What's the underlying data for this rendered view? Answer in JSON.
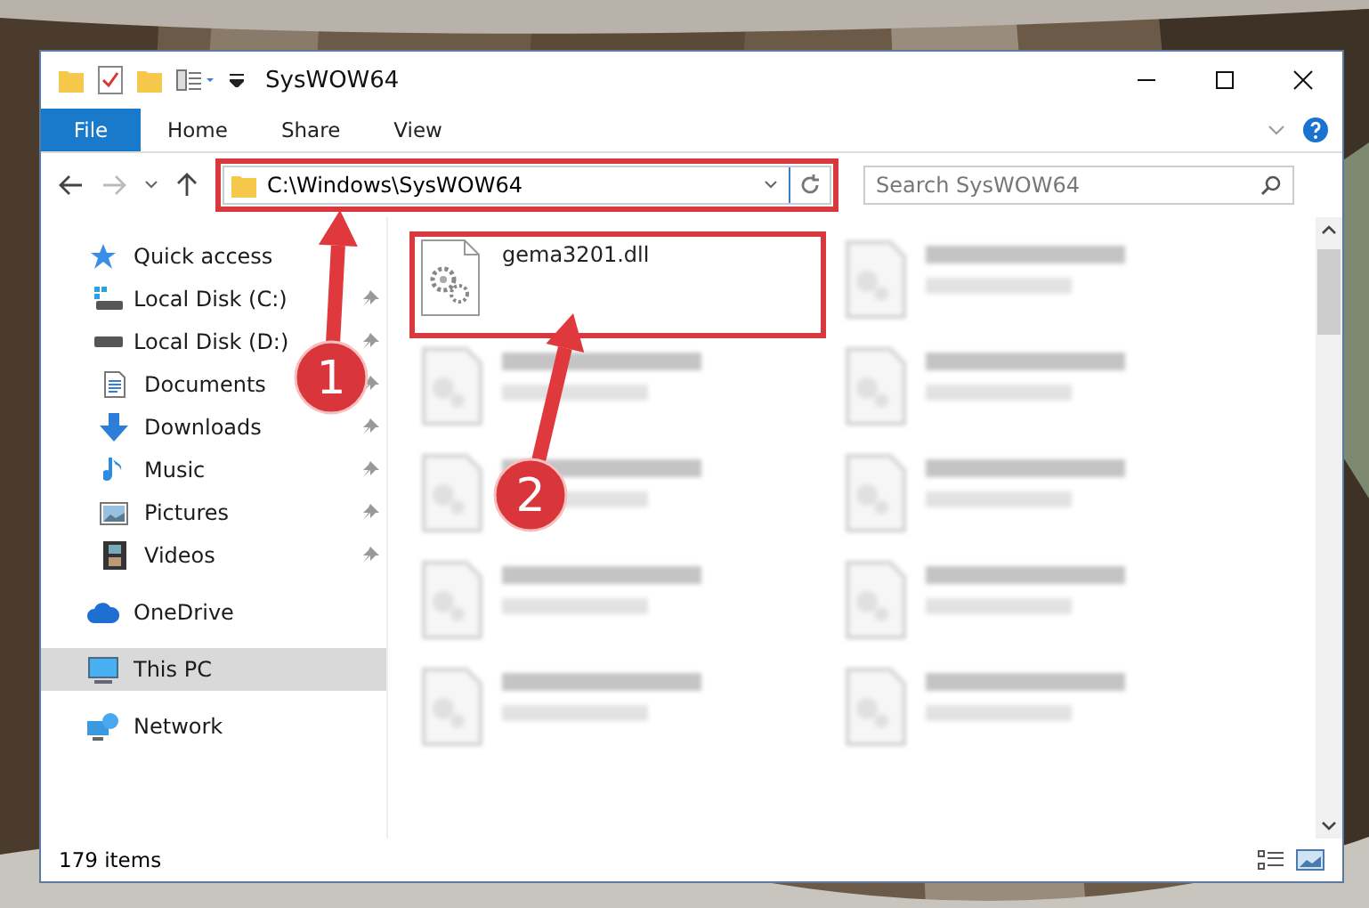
{
  "window": {
    "title": "SysWOW64"
  },
  "ribbon": {
    "tabs": [
      {
        "label": "File",
        "kind": "menu"
      },
      {
        "label": "Home",
        "kind": "tab"
      },
      {
        "label": "Share",
        "kind": "tab"
      },
      {
        "label": "View",
        "kind": "tab"
      }
    ]
  },
  "address_bar": {
    "path": "C:\\Windows\\SysWOW64",
    "highlighted": true
  },
  "search": {
    "placeholder": "Search SysWOW64"
  },
  "nav_pane": {
    "items": [
      {
        "label": "Quick access",
        "kind": "star",
        "selected": false,
        "children": [
          {
            "label": "Local Disk (C:)",
            "kind": "system-drive",
            "pinned": true,
            "selected": false
          },
          {
            "label": "Local Disk (D:)",
            "kind": "drive",
            "pinned": true,
            "selected": false
          },
          {
            "label": "Documents",
            "kind": "document",
            "pinned": true,
            "selected": false
          },
          {
            "label": "Downloads",
            "kind": "download",
            "pinned": true,
            "selected": false
          },
          {
            "label": "Music",
            "kind": "music",
            "pinned": true,
            "selected": false
          },
          {
            "label": "Pictures",
            "kind": "pictures",
            "pinned": true,
            "selected": false
          },
          {
            "label": "Videos",
            "kind": "video",
            "pinned": true,
            "selected": false
          }
        ]
      },
      {
        "label": "OneDrive",
        "kind": "cloud",
        "selected": false
      },
      {
        "label": "This PC",
        "kind": "pc",
        "selected": true
      },
      {
        "label": "Network",
        "kind": "network",
        "selected": false
      }
    ]
  },
  "files": [
    {
      "kind": "file",
      "name": "gema3201.dll",
      "highlighted": true
    },
    {
      "kind": "blurred",
      "highlighted": false
    },
    {
      "kind": "blurred",
      "highlighted": false
    },
    {
      "kind": "blurred",
      "highlighted": false
    },
    {
      "kind": "blurred",
      "highlighted": false
    },
    {
      "kind": "blurred",
      "highlighted": false
    },
    {
      "kind": "blurred",
      "highlighted": false
    },
    {
      "kind": "blurred",
      "highlighted": false
    },
    {
      "kind": "blurred",
      "highlighted": false
    },
    {
      "kind": "blurred",
      "highlighted": false
    }
  ],
  "status_bar": {
    "item_count": "179 items"
  },
  "annotations": [
    {
      "number": "1"
    },
    {
      "number": "2"
    }
  ]
}
